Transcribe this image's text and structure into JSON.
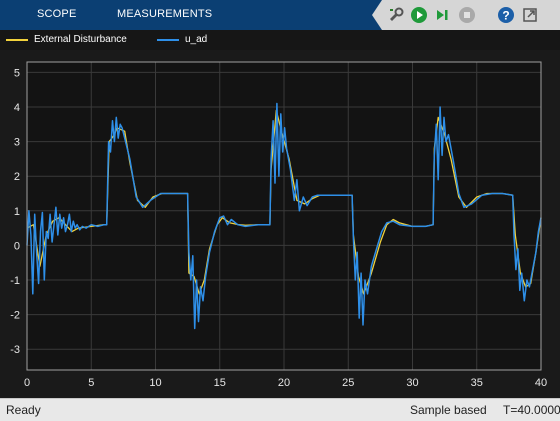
{
  "toolbar": {
    "tabs": [
      {
        "label": "SCOPE"
      },
      {
        "label": "MEASUREMENTS"
      }
    ],
    "icons": [
      "signal-tools-icon",
      "run-icon",
      "step-forward-icon",
      "stop-icon",
      "help-icon",
      "undock-icon"
    ]
  },
  "legend": [
    {
      "label": "External Disturbance",
      "color": "#f2d23c"
    },
    {
      "label": "u_ad",
      "color": "#2e8fe8"
    }
  ],
  "chart_data": {
    "type": "line",
    "xlim": [
      0,
      40
    ],
    "ylim": [
      -3.6,
      5.3
    ],
    "xticks": [
      0,
      5,
      10,
      15,
      20,
      25,
      30,
      35,
      40
    ],
    "yticks": [
      -3,
      -2,
      -1,
      0,
      1,
      2,
      3,
      4,
      5
    ],
    "grid": true,
    "legend_position": "top",
    "series": [
      {
        "name": "External Disturbance",
        "color": "#f2d23c",
        "points": [
          [
            0,
            0.5
          ],
          [
            0.5,
            0.6
          ],
          [
            1,
            -0.6
          ],
          [
            1.5,
            0.3
          ],
          [
            2,
            0.7
          ],
          [
            2.5,
            0.8
          ],
          [
            3,
            0.6
          ],
          [
            3.5,
            0.4
          ],
          [
            4,
            0.5
          ],
          [
            5,
            0.55
          ],
          [
            6,
            0.6
          ],
          [
            6.2,
            0.6
          ],
          [
            6.4,
            3.0
          ],
          [
            6.8,
            3.2
          ],
          [
            7,
            3.4
          ],
          [
            7.6,
            3.3
          ],
          [
            8,
            2.4
          ],
          [
            8.6,
            1.3
          ],
          [
            9.2,
            1.1
          ],
          [
            9.8,
            1.4
          ],
          [
            10.5,
            1.5
          ],
          [
            11.5,
            1.5
          ],
          [
            12.5,
            1.5
          ],
          [
            12.6,
            -0.8
          ],
          [
            13.0,
            -0.9
          ],
          [
            13.4,
            -1.4
          ],
          [
            13.8,
            -1.0
          ],
          [
            14.2,
            -0.1
          ],
          [
            14.8,
            0.6
          ],
          [
            15.2,
            0.8
          ],
          [
            15.8,
            0.65
          ],
          [
            16.5,
            0.6
          ],
          [
            17,
            0.58
          ],
          [
            18,
            0.6
          ],
          [
            18.9,
            0.6
          ],
          [
            19.0,
            2.2
          ],
          [
            19.4,
            3.9
          ],
          [
            19.8,
            3.3
          ],
          [
            20.4,
            2.5
          ],
          [
            21.0,
            1.3
          ],
          [
            21.6,
            1.2
          ],
          [
            22.2,
            1.35
          ],
          [
            22.8,
            1.45
          ],
          [
            24,
            1.45
          ],
          [
            25.3,
            1.45
          ],
          [
            25.4,
            0.3
          ],
          [
            25.8,
            -0.9
          ],
          [
            26.2,
            -1.4
          ],
          [
            26.8,
            -0.8
          ],
          [
            27.5,
            0.1
          ],
          [
            28,
            0.6
          ],
          [
            28.5,
            0.75
          ],
          [
            29,
            0.65
          ],
          [
            30,
            0.55
          ],
          [
            31,
            0.55
          ],
          [
            31.6,
            0.6
          ],
          [
            31.7,
            2.8
          ],
          [
            32,
            3.7
          ],
          [
            32.5,
            3.2
          ],
          [
            33,
            2.5
          ],
          [
            33.6,
            1.4
          ],
          [
            34.2,
            1.1
          ],
          [
            35,
            1.4
          ],
          [
            35.8,
            1.5
          ],
          [
            37,
            1.5
          ],
          [
            37.8,
            1.45
          ],
          [
            38,
            0.3
          ],
          [
            38.4,
            -0.8
          ],
          [
            38.8,
            -1.2
          ],
          [
            39.2,
            -1.1
          ],
          [
            39.6,
            -0.2
          ],
          [
            40,
            0.8
          ]
        ]
      },
      {
        "name": "u_ad",
        "color": "#2e8fe8",
        "points": [
          [
            0,
            0.0
          ],
          [
            0.15,
            1.0
          ],
          [
            0.3,
            0.3
          ],
          [
            0.45,
            -1.4
          ],
          [
            0.6,
            0.9
          ],
          [
            0.75,
            -0.2
          ],
          [
            0.9,
            -1.1
          ],
          [
            1.05,
            0.4
          ],
          [
            1.2,
            0.95
          ],
          [
            1.35,
            -1.0
          ],
          [
            1.5,
            0.4
          ],
          [
            1.65,
            0.2
          ],
          [
            1.8,
            0.9
          ],
          [
            1.95,
            0.1
          ],
          [
            2.1,
            0.6
          ],
          [
            2.25,
            1.1
          ],
          [
            2.4,
            0.3
          ],
          [
            2.55,
            0.9
          ],
          [
            2.7,
            0.5
          ],
          [
            2.85,
            0.8
          ],
          [
            3.0,
            0.4
          ],
          [
            3.15,
            0.6
          ],
          [
            3.3,
            0.9
          ],
          [
            3.45,
            0.4
          ],
          [
            3.6,
            0.7
          ],
          [
            3.75,
            0.5
          ],
          [
            3.9,
            0.6
          ],
          [
            4.1,
            0.45
          ],
          [
            4.3,
            0.55
          ],
          [
            4.6,
            0.5
          ],
          [
            5,
            0.6
          ],
          [
            5.5,
            0.55
          ],
          [
            6,
            0.6
          ],
          [
            6.2,
            0.6
          ],
          [
            6.35,
            3.0
          ],
          [
            6.5,
            2.7
          ],
          [
            6.65,
            3.6
          ],
          [
            6.8,
            3.0
          ],
          [
            6.95,
            3.7
          ],
          [
            7.1,
            3.1
          ],
          [
            7.25,
            3.5
          ],
          [
            7.4,
            3.4
          ],
          [
            7.6,
            3.1
          ],
          [
            8,
            2.5
          ],
          [
            8.5,
            1.4
          ],
          [
            9.0,
            1.1
          ],
          [
            9.6,
            1.3
          ],
          [
            10.4,
            1.5
          ],
          [
            11.5,
            1.5
          ],
          [
            12.5,
            1.5
          ],
          [
            12.6,
            -0.2
          ],
          [
            12.75,
            -1.0
          ],
          [
            12.9,
            -0.3
          ],
          [
            13.05,
            -2.4
          ],
          [
            13.2,
            -1.0
          ],
          [
            13.35,
            -2.2
          ],
          [
            13.5,
            -1.2
          ],
          [
            13.7,
            -1.6
          ],
          [
            13.9,
            -0.9
          ],
          [
            14.2,
            -0.2
          ],
          [
            14.6,
            0.4
          ],
          [
            15.0,
            0.8
          ],
          [
            15.3,
            0.85
          ],
          [
            15.6,
            0.6
          ],
          [
            15.9,
            0.75
          ],
          [
            16.4,
            0.6
          ],
          [
            17,
            0.55
          ],
          [
            18,
            0.6
          ],
          [
            18.9,
            0.6
          ],
          [
            19.0,
            2.5
          ],
          [
            19.15,
            3.6
          ],
          [
            19.3,
            1.8
          ],
          [
            19.45,
            4.1
          ],
          [
            19.6,
            2.0
          ],
          [
            19.75,
            3.8
          ],
          [
            19.9,
            2.7
          ],
          [
            20.05,
            3.4
          ],
          [
            20.2,
            2.8
          ],
          [
            20.5,
            2.2
          ],
          [
            20.8,
            1.3
          ],
          [
            21.0,
            1.9
          ],
          [
            21.2,
            1.0
          ],
          [
            21.5,
            1.4
          ],
          [
            21.8,
            1.15
          ],
          [
            22.2,
            1.4
          ],
          [
            22.6,
            1.45
          ],
          [
            23.5,
            1.45
          ],
          [
            25.3,
            1.45
          ],
          [
            25.4,
            0.2
          ],
          [
            25.55,
            -1.0
          ],
          [
            25.7,
            -0.2
          ],
          [
            25.85,
            -2.1
          ],
          [
            26.0,
            -0.8
          ],
          [
            26.15,
            -2.3
          ],
          [
            26.3,
            -1.0
          ],
          [
            26.5,
            -1.4
          ],
          [
            26.8,
            -0.6
          ],
          [
            27.2,
            -0.1
          ],
          [
            27.6,
            0.4
          ],
          [
            28,
            0.65
          ],
          [
            28.5,
            0.7
          ],
          [
            29,
            0.6
          ],
          [
            30,
            0.55
          ],
          [
            31,
            0.55
          ],
          [
            31.6,
            0.6
          ],
          [
            31.7,
            2.6
          ],
          [
            31.85,
            3.5
          ],
          [
            32.0,
            1.9
          ],
          [
            32.15,
            4.0
          ],
          [
            32.3,
            2.6
          ],
          [
            32.45,
            3.7
          ],
          [
            32.6,
            3.0
          ],
          [
            32.8,
            3.2
          ],
          [
            33.2,
            2.4
          ],
          [
            33.6,
            1.5
          ],
          [
            34.0,
            1.1
          ],
          [
            34.6,
            1.2
          ],
          [
            35.4,
            1.45
          ],
          [
            36.2,
            1.5
          ],
          [
            37,
            1.5
          ],
          [
            37.8,
            1.45
          ],
          [
            37.9,
            0.3
          ],
          [
            38.05,
            -0.7
          ],
          [
            38.2,
            -0.1
          ],
          [
            38.35,
            -1.3
          ],
          [
            38.5,
            -0.8
          ],
          [
            38.7,
            -1.6
          ],
          [
            38.9,
            -1.0
          ],
          [
            39.1,
            -1.2
          ],
          [
            39.3,
            -0.8
          ],
          [
            39.6,
            -0.2
          ],
          [
            39.8,
            0.4
          ],
          [
            40,
            0.8
          ]
        ]
      }
    ]
  },
  "status": {
    "left": "Ready",
    "mode": "Sample based",
    "time": "T=40.0000"
  }
}
